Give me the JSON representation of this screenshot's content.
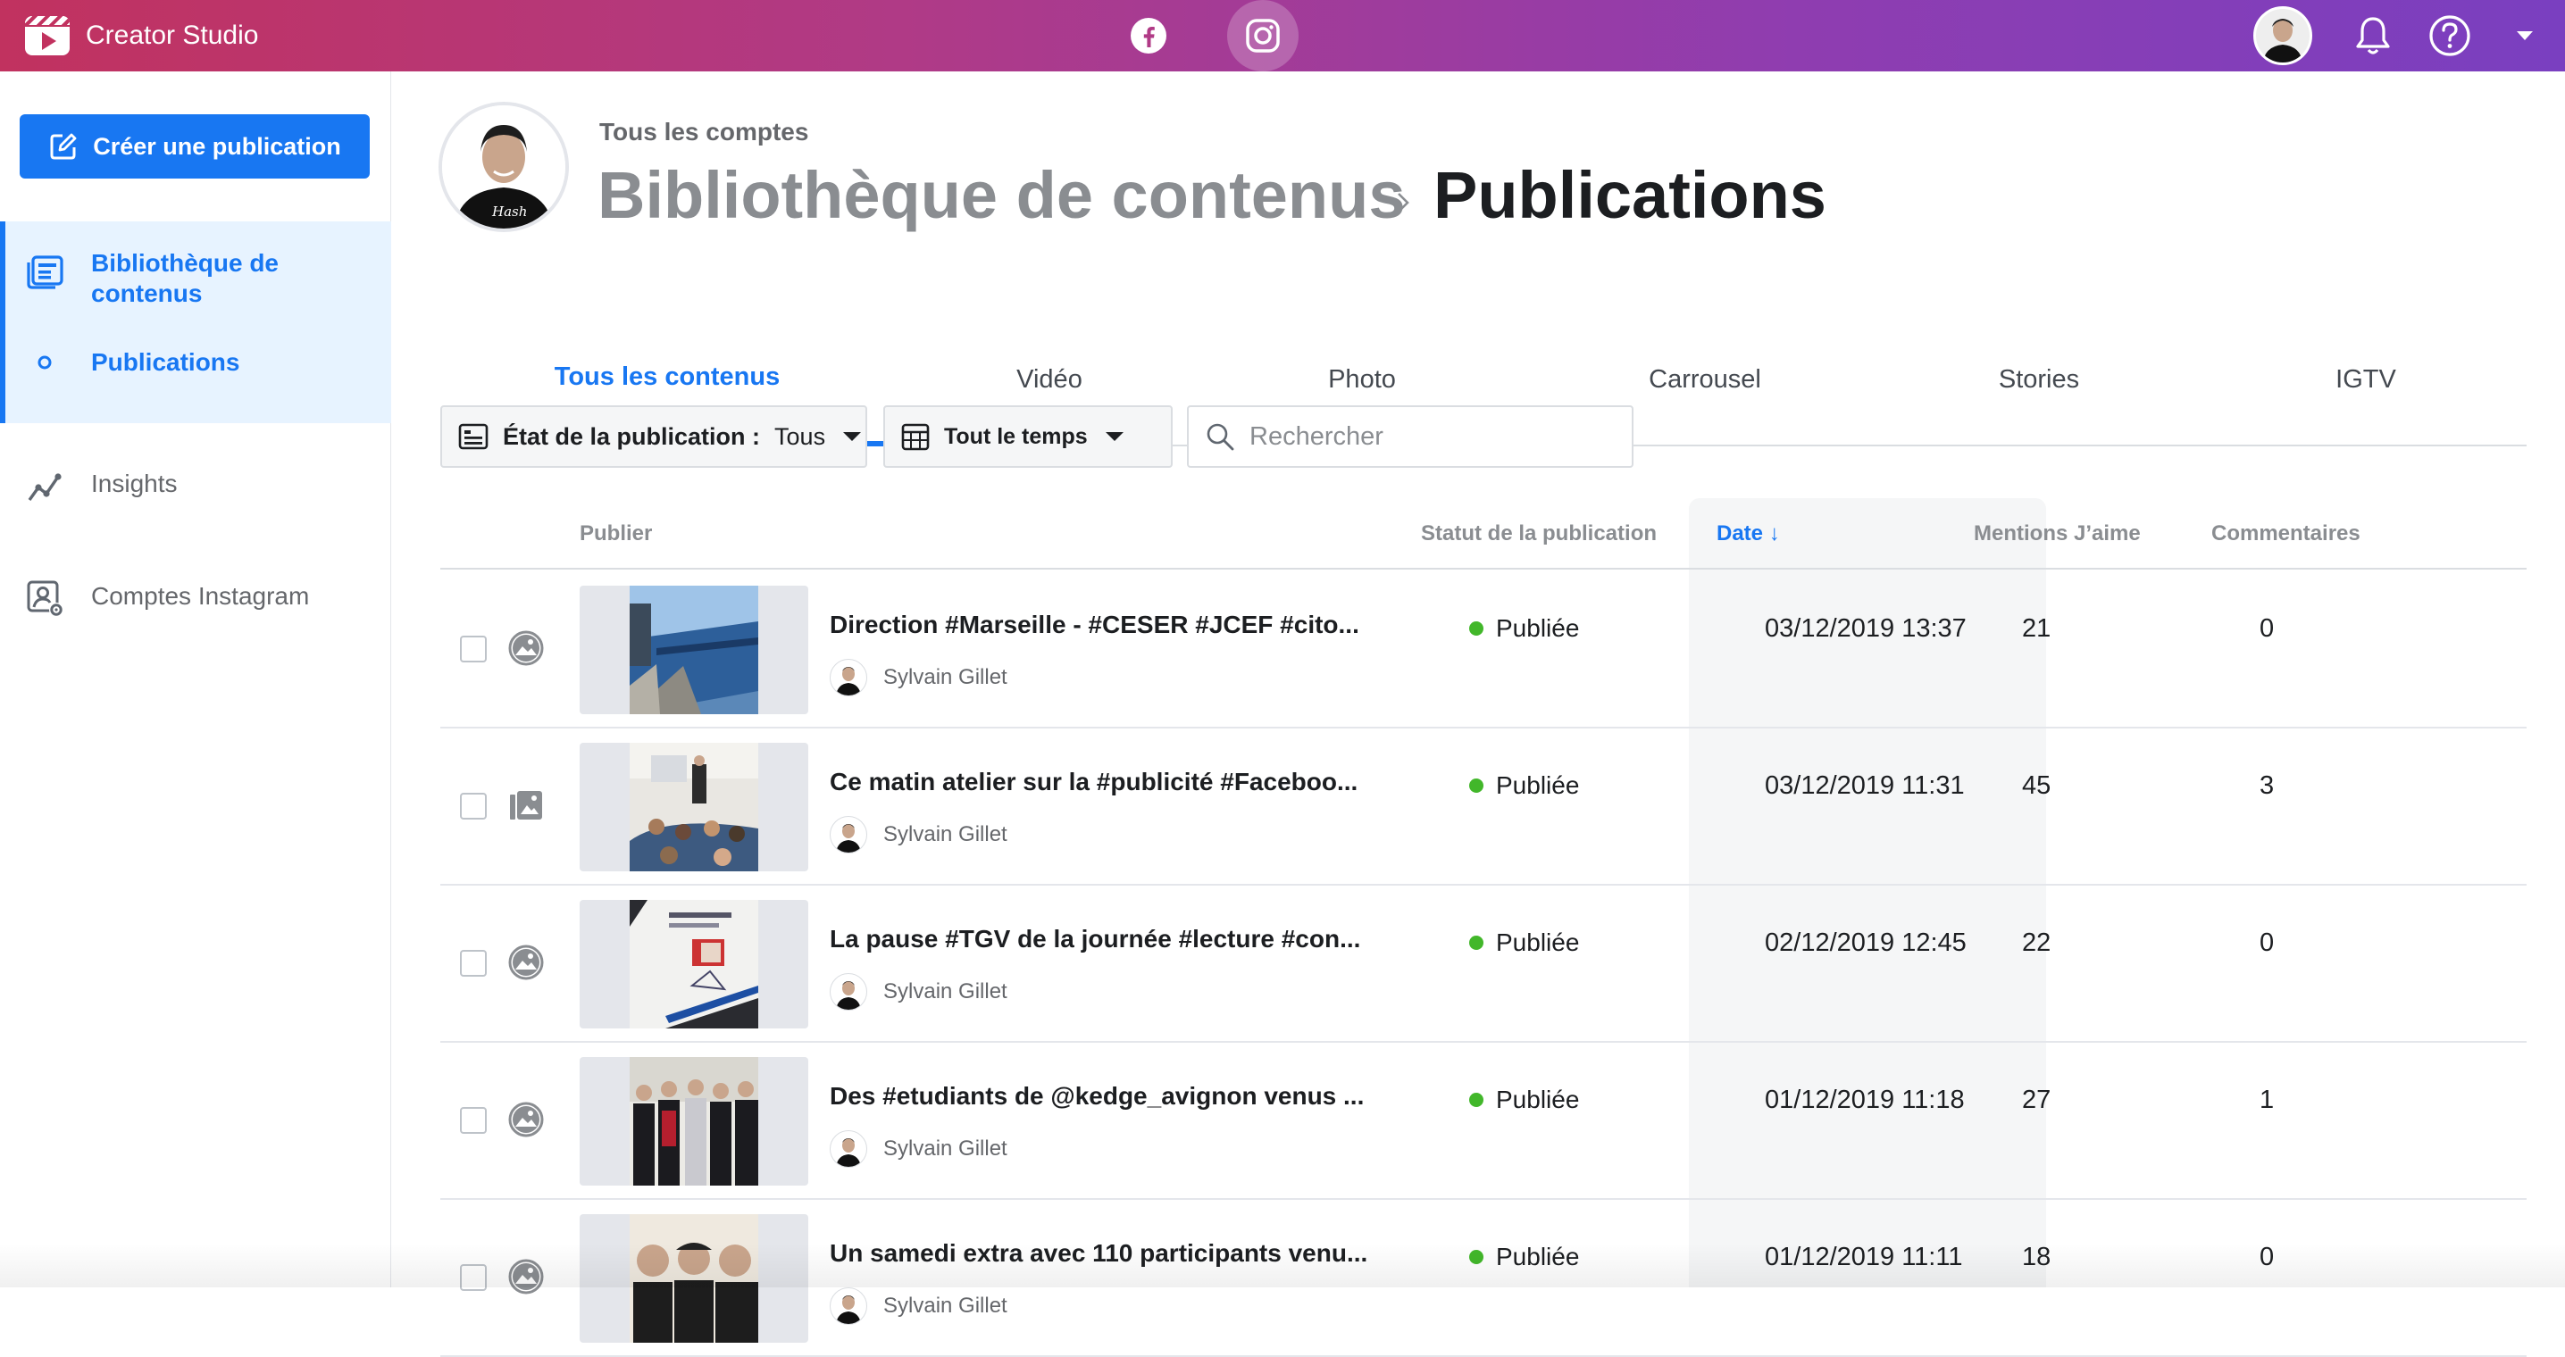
{
  "app": {
    "title": "Creator Studio"
  },
  "sidebar": {
    "create_label": "Créer une publication",
    "items": [
      {
        "label": "Bibliothèque de contenus",
        "icon": "content-library-icon"
      },
      {
        "label": "Publications",
        "icon": "circle-bullet-icon"
      },
      {
        "label": "Insights",
        "icon": "insights-chart-icon"
      },
      {
        "label": "Comptes Instagram",
        "icon": "account-settings-icon"
      }
    ]
  },
  "header": {
    "account_label": "Tous les comptes",
    "breadcrumb_parent": "Bibliothèque de contenus",
    "breadcrumb_current": "Publications"
  },
  "tabs": [
    "Tous les contenus",
    "Vidéo",
    "Photo",
    "Carrousel",
    "Stories",
    "IGTV"
  ],
  "filters": {
    "state_label": "État de la publication :",
    "state_value": "Tous",
    "time_label": "Tout le temps",
    "search_placeholder": "Rechercher"
  },
  "table": {
    "headers": {
      "publisher": "Publier",
      "status": "Statut de la publication",
      "date": "Date ↓",
      "likes": "Mentions J’aime",
      "comments": "Commentaires"
    },
    "rows": [
      {
        "caption": "Direction #Marseille - #CESER #JCEF #cito...",
        "author": "Sylvain Gillet",
        "status": "Publiée",
        "date": "03/12/2019 13:37",
        "likes": "21",
        "comments": "0",
        "type": "photo"
      },
      {
        "caption": "Ce matin atelier sur la #publicité #Faceboo...",
        "author": "Sylvain Gillet",
        "status": "Publiée",
        "date": "03/12/2019 11:31",
        "likes": "45",
        "comments": "3",
        "type": "carousel"
      },
      {
        "caption": "La pause #TGV de la journée #lecture #con...",
        "author": "Sylvain Gillet",
        "status": "Publiée",
        "date": "02/12/2019 12:45",
        "likes": "22",
        "comments": "0",
        "type": "photo"
      },
      {
        "caption": "Des #etudiants de @kedge_avignon venus ...",
        "author": "Sylvain Gillet",
        "status": "Publiée",
        "date": "01/12/2019 11:18",
        "likes": "27",
        "comments": "1",
        "type": "photo"
      },
      {
        "caption": "Un samedi extra avec 110 participants venu...",
        "author": "Sylvain Gillet",
        "status": "Publiée",
        "date": "01/12/2019 11:11",
        "likes": "18",
        "comments": "0",
        "type": "photo"
      }
    ]
  },
  "colors": {
    "accent": "#1877f2",
    "published": "#42b72a"
  }
}
